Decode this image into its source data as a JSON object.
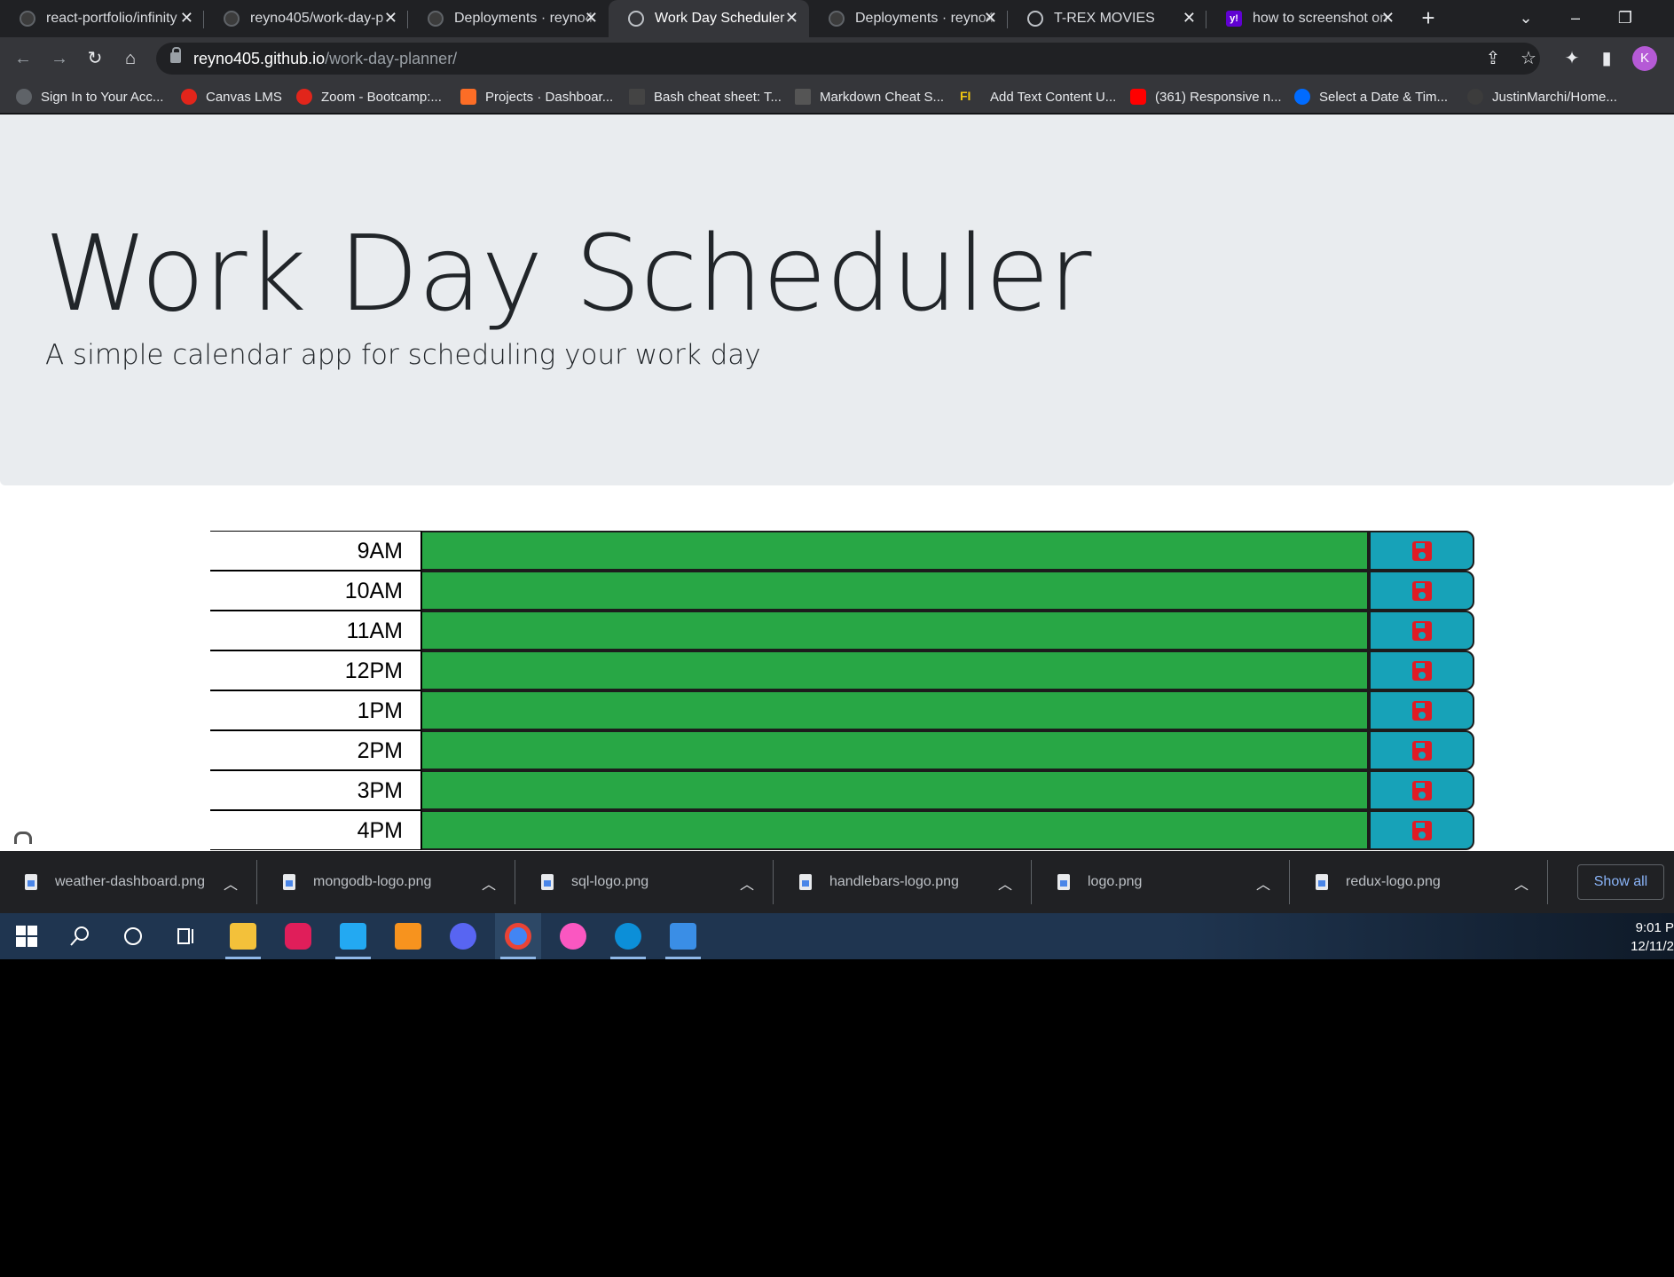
{
  "browser": {
    "tabs": [
      {
        "title": "react-portfolio/infinity",
        "icon": "github-icon"
      },
      {
        "title": "reyno405/work-day-p",
        "icon": "github-icon"
      },
      {
        "title": "Deployments · reyno4",
        "icon": "github-icon"
      },
      {
        "title": "Work Day Scheduler",
        "icon": "globe-icon",
        "active": true
      },
      {
        "title": "Deployments · reyno4",
        "icon": "github-icon"
      },
      {
        "title": "T-REX MOVIES",
        "icon": "globe-icon"
      },
      {
        "title": "how to screenshot on",
        "icon": "yahoo-icon",
        "icon_text": "y!"
      }
    ],
    "address": {
      "host": "reyno405.github.io",
      "path": "/work-day-planner/"
    },
    "profile_initial": "K",
    "bookmarks": [
      {
        "label": "Sign In to Your Acc...",
        "color": "#5f6368"
      },
      {
        "label": "Canvas LMS",
        "color": "#e1251b"
      },
      {
        "label": "Zoom - Bootcamp:...",
        "color": "#e1251b"
      },
      {
        "label": "Projects · Dashboar...",
        "color": "#fc6d26"
      },
      {
        "label": "Bash cheat sheet: T...",
        "color": "#444444"
      },
      {
        "label": "Markdown Cheat S...",
        "color": "#555555"
      },
      {
        "label": "Add Text Content U...",
        "color": "#f2c811",
        "icon_text": "FI"
      },
      {
        "label": "(361) Responsive n...",
        "color": "#ff0000"
      },
      {
        "label": "Select a Date & Tim...",
        "color": "#006bff"
      },
      {
        "label": "JustinMarchi/Home...",
        "color": "#3c3c3c"
      }
    ]
  },
  "page": {
    "title": "Work Day Scheduler",
    "lead": "A simple calendar app for scheduling your work day",
    "hours": [
      {
        "label": "9AM",
        "text": ""
      },
      {
        "label": "10AM",
        "text": ""
      },
      {
        "label": "11AM",
        "text": ""
      },
      {
        "label": "12PM",
        "text": ""
      },
      {
        "label": "1PM",
        "text": ""
      },
      {
        "label": "2PM",
        "text": ""
      },
      {
        "label": "3PM",
        "text": ""
      },
      {
        "label": "4PM",
        "text": ""
      }
    ],
    "colors": {
      "future": "#28a745",
      "save": "#17a2b8",
      "save_icon": "#e01b24"
    }
  },
  "downloads": {
    "files": [
      "weather-dashboard.png",
      "mongodb-logo.png",
      "sql-logo.png",
      "handlebars-logo.png",
      "logo.png",
      "redux-logo.png"
    ],
    "show_all_label": "Show all"
  },
  "taskbar": {
    "apps": [
      {
        "name": "file-explorer-icon",
        "color": "#f3c13a",
        "open": true
      },
      {
        "name": "slack-icon",
        "color": "#e01e5a"
      },
      {
        "name": "vscode-icon",
        "color": "#23a9f2",
        "open": true
      },
      {
        "name": "app-icon",
        "color": "#f7931e"
      },
      {
        "name": "discord-icon",
        "color": "#5865f2"
      },
      {
        "name": "chrome-icon",
        "color": "#4285f4",
        "open": true
      },
      {
        "name": "itunes-icon",
        "color": "#fa57c1"
      },
      {
        "name": "edge-icon",
        "color": "#0c8fd8",
        "open": true
      },
      {
        "name": "photos-icon",
        "color": "#3a8ee6",
        "open": true
      }
    ],
    "time": "9:01 P",
    "date": "12/11/2"
  }
}
